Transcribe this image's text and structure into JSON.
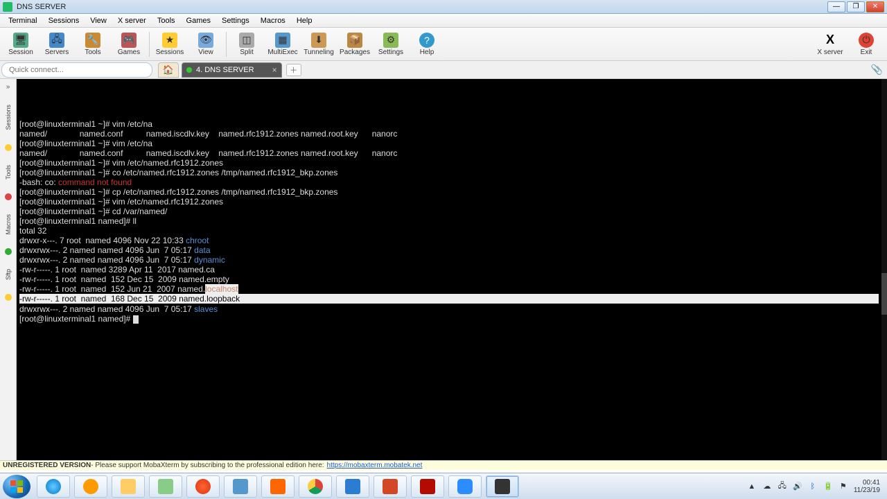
{
  "window": {
    "title": "DNS SERVER"
  },
  "menu": {
    "items": [
      "Terminal",
      "Sessions",
      "View",
      "X server",
      "Tools",
      "Games",
      "Settings",
      "Macros",
      "Help"
    ]
  },
  "toolbar": {
    "buttons": [
      "Session",
      "Servers",
      "Tools",
      "Games",
      "Sessions",
      "View",
      "Split",
      "MultiExec",
      "Tunneling",
      "Packages",
      "Settings",
      "Help"
    ],
    "right": {
      "xserver": "X server",
      "exit": "Exit"
    }
  },
  "quick": {
    "placeholder": "Quick connect..."
  },
  "tab": {
    "label": "4. DNS SERVER"
  },
  "sidebar": {
    "items": [
      "Sessions",
      "Tools",
      "Macros",
      "Sftp"
    ]
  },
  "terminal": {
    "lines": [
      {
        "t": "[root@linuxterminal1 ~]# vim /etc/na"
      },
      {
        "t": "named/              named.conf          named.iscdlv.key    named.rfc1912.zones named.root.key      nanorc"
      },
      {
        "t": "[root@linuxterminal1 ~]# vim /etc/na"
      },
      {
        "t": "named/              named.conf          named.iscdlv.key    named.rfc1912.zones named.root.key      nanorc"
      },
      {
        "t": "[root@linuxterminal1 ~]# vim /etc/named.rfc1912.zones"
      },
      {
        "t": "[root@linuxterminal1 ~]# co /etc/named.rfc1912.zones /tmp/named.rfc1912_bkp.zones"
      },
      {
        "pre": "-bash: co: ",
        "err": "command not found"
      },
      {
        "t": "[root@linuxterminal1 ~]# cp /etc/named.rfc1912.zones /tmp/named.rfc1912_bkp.zones"
      },
      {
        "t": "[root@linuxterminal1 ~]# vim /etc/named.rfc1912.zones"
      },
      {
        "t": "[root@linuxterminal1 ~]# cd /var/named/"
      },
      {
        "t": "[root@linuxterminal1 named]# ll"
      },
      {
        "t": "total 32"
      },
      {
        "pre": "drwxr-x---. 7 root  named 4096 Nov 22 10:33 ",
        "dir": "chroot"
      },
      {
        "pre": "drwxrwx---. 2 named named 4096 Jun  7 05:17 ",
        "dir": "data"
      },
      {
        "pre": "drwxrwx---. 2 named named 4096 Jun  7 05:17 ",
        "dir": "dynamic"
      },
      {
        "t": "-rw-r-----. 1 root  named 3289 Apr 11  2017 named.ca"
      },
      {
        "t": "-rw-r-----. 1 root  named  152 Dec 15  2009 named.empty"
      },
      {
        "pre": "-rw-r-----. 1 root  named  152 Jun 21  2007 named.",
        "mag": "localhost"
      },
      {
        "hl": true,
        "t": "-rw-r-----. 1 root  named  168 Dec 15  2009 named.loopback"
      },
      {
        "pre": "drwxrwx---. 2 named named 4096 Jun  7 05:17 ",
        "dir": "slaves"
      },
      {
        "t": "[root@linuxterminal1 named]# ",
        "cursor": true
      }
    ]
  },
  "status": {
    "unreg": "UNREGISTERED VERSION",
    "msg": " - Please support MobaXterm by subscribing to the professional edition here: ",
    "url": "https://mobaxterm.mobatek.net"
  },
  "tray": {
    "time": "00:41",
    "date": "11/23/19"
  }
}
